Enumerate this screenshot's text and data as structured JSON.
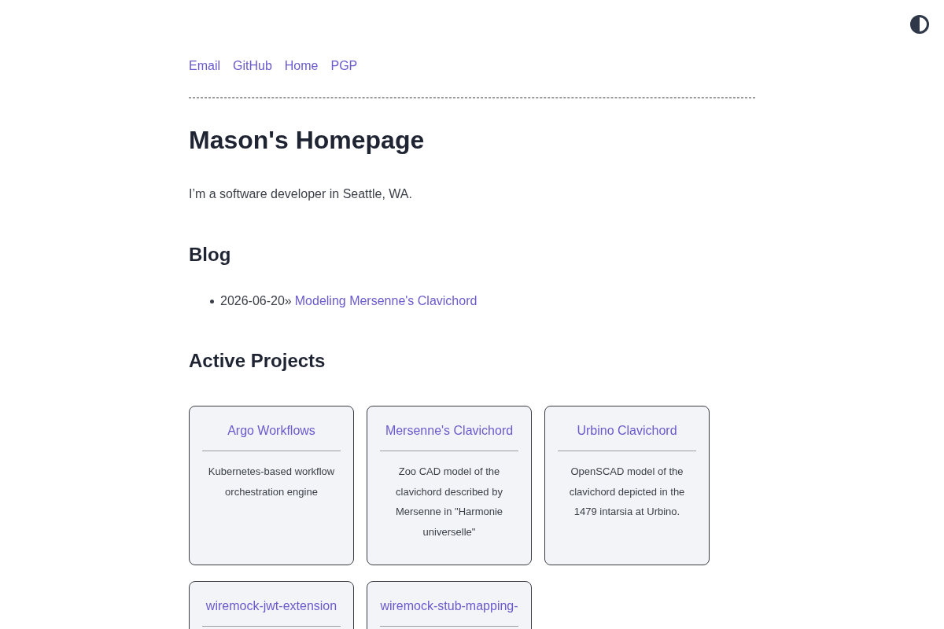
{
  "nav_links": [
    "Email",
    "GitHub",
    "Home",
    "PGP"
  ],
  "title": "Mason's Homepage",
  "intro": "I’m a software developer in Seattle, WA.",
  "blog": {
    "heading": "Blog",
    "posts": [
      {
        "date": "2026-06-20»",
        "title": "Modeling Mersenne's Clavichord"
      }
    ]
  },
  "projects": {
    "heading": "Active Projects",
    "cards": [
      {
        "title": "Argo Workflows",
        "description": "Kubernetes-based workflow orchestration engine"
      },
      {
        "title": "Mersenne's Clavichord",
        "description": "Zoo CAD model of the clavichord described by Mersenne in \"Harmonie universelle\""
      },
      {
        "title": "Urbino Clavichord",
        "description": "OpenSCAD model of the clavichord depicted in the 1479 intarsia at Urbino."
      },
      {
        "title": "wiremock-jwt-extension"
      },
      {
        "title": "wiremock-stub-mapping-"
      }
    ]
  }
}
